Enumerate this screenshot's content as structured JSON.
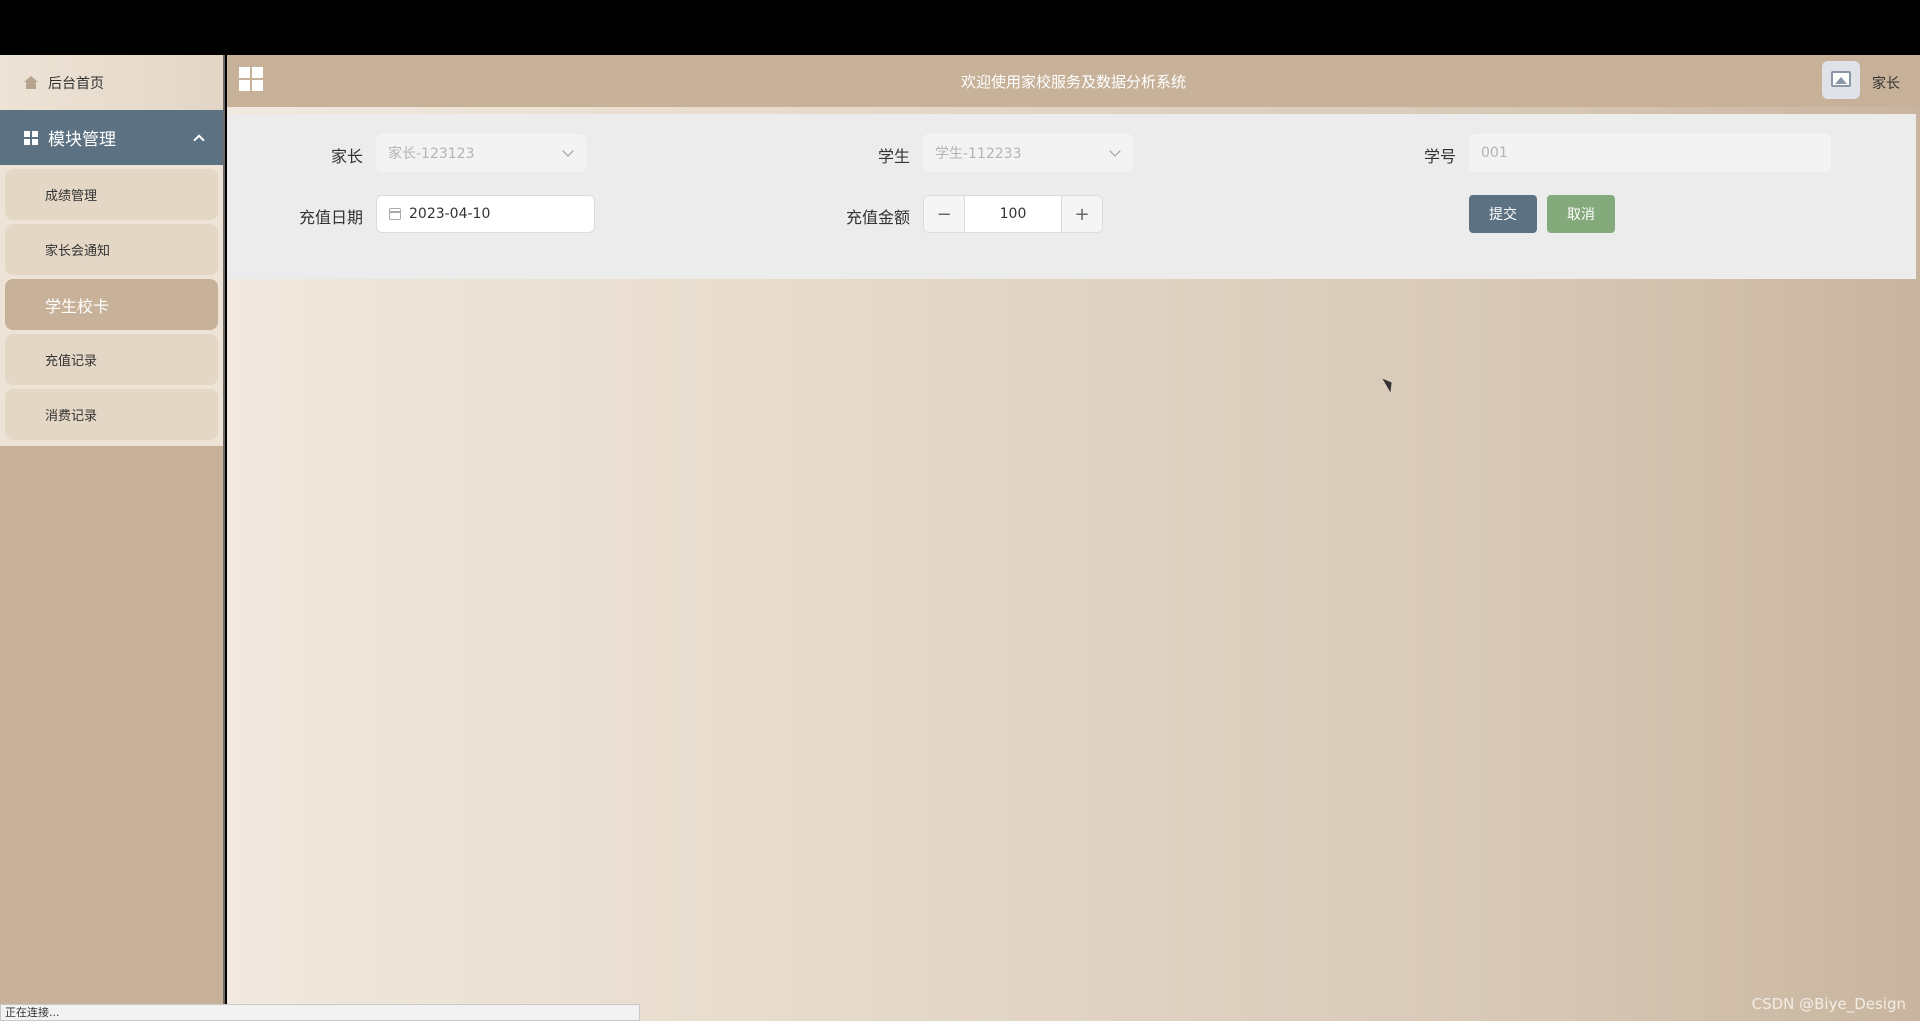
{
  "header": {
    "title": "欢迎使用家校服务及数据分析系统",
    "user_role": "家长"
  },
  "sidebar": {
    "home_label": "后台首页",
    "module_label": "模块管理",
    "items": [
      {
        "label": "成绩管理"
      },
      {
        "label": "家长会通知"
      },
      {
        "label": "学生校卡"
      },
      {
        "label": "充值记录"
      },
      {
        "label": "消费记录"
      }
    ]
  },
  "form": {
    "parent_label": "家长",
    "parent_value": "家长-123123",
    "student_label": "学生",
    "student_value": "学生-112233",
    "student_no_label": "学号",
    "student_no_value": "001",
    "date_label": "充值日期",
    "date_value": "2023-04-10",
    "amount_label": "充值金额",
    "amount_value": "100",
    "minus": "−",
    "plus": "+",
    "submit_label": "提交",
    "cancel_label": "取消"
  },
  "status_text": "正在连接...",
  "watermark": "CSDN @Biye_Design",
  "colors": {
    "sidebar_bg": "#c7b199",
    "module_header_bg": "#5c7283",
    "submit_bg": "#5c7283",
    "cancel_bg": "#84a97b"
  }
}
